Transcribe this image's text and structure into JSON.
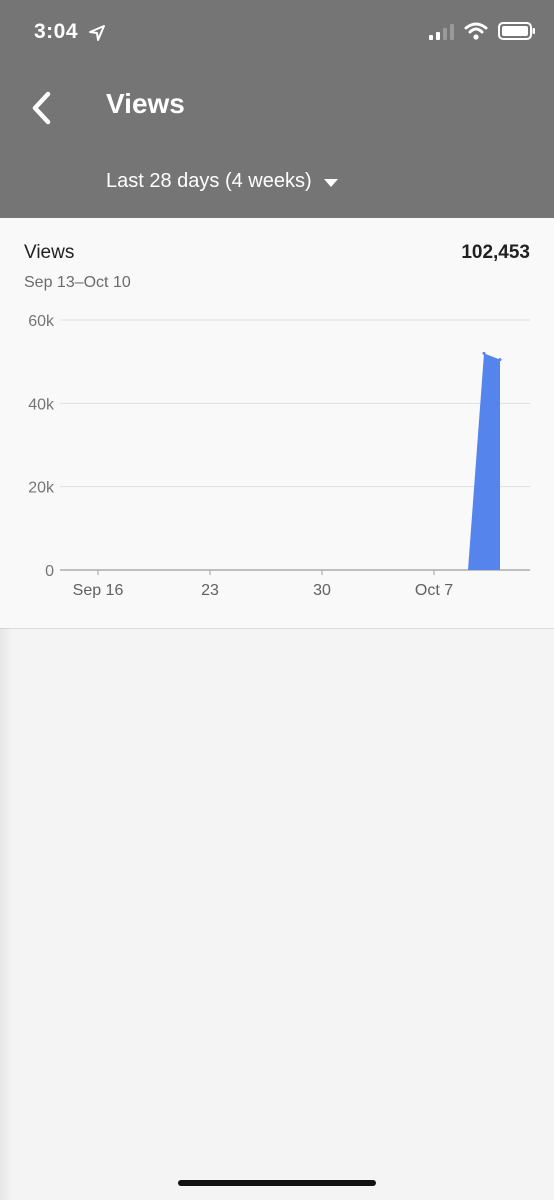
{
  "status_bar": {
    "time": "3:04"
  },
  "header": {
    "title": "Views",
    "date_range": "Last 28 days (4 weeks)"
  },
  "card": {
    "metric_name": "Views",
    "metric_total": "102,453",
    "period": "Sep 13–Oct 10"
  },
  "colors": {
    "header_bg": "#757575",
    "series": "#5484ec"
  },
  "chart_data": {
    "type": "area",
    "x": [
      "Sep 13",
      "Sep 14",
      "Sep 15",
      "Sep 16",
      "Sep 17",
      "Sep 18",
      "Sep 19",
      "Sep 20",
      "Sep 21",
      "Sep 22",
      "Sep 23",
      "Sep 24",
      "Sep 25",
      "Sep 26",
      "Sep 27",
      "Sep 28",
      "Sep 29",
      "Sep 30",
      "Oct 1",
      "Oct 2",
      "Oct 3",
      "Oct 4",
      "Oct 5",
      "Oct 6",
      "Oct 7",
      "Oct 8",
      "Oct 9",
      "Oct 10"
    ],
    "values": [
      0,
      0,
      0,
      0,
      0,
      0,
      0,
      0,
      0,
      0,
      0,
      0,
      0,
      0,
      0,
      0,
      0,
      0,
      0,
      0,
      0,
      0,
      0,
      0,
      0,
      0,
      52000,
      50500
    ],
    "x_ticks": [
      {
        "label": "Sep 16",
        "x": "Sep 16"
      },
      {
        "label": "23",
        "x": "Sep 23"
      },
      {
        "label": "30",
        "x": "Sep 30"
      },
      {
        "label": "Oct 7",
        "x": "Oct 7"
      }
    ],
    "y_ticks": [
      0,
      20000,
      40000,
      60000
    ],
    "y_tick_labels": [
      "0",
      "20k",
      "40k",
      "60k"
    ],
    "ylim": [
      0,
      60000
    ],
    "grid": true
  }
}
